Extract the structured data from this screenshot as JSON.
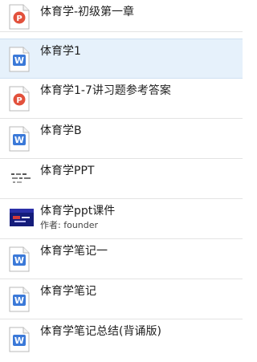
{
  "files": [
    {
      "title": "体育学-初级第一章",
      "icon": "pdf-icon"
    },
    {
      "title": "体育学1",
      "icon": "word-icon"
    },
    {
      "title": "体育学1-7讲习题参考答案",
      "icon": "pdf-icon"
    },
    {
      "title": "体育学B",
      "icon": "word-icon"
    },
    {
      "title": "体育学PPT",
      "icon": "ppt-thumbnail"
    },
    {
      "title": "体育学ppt课件",
      "icon": "video-thumbnail",
      "author_label": "作者:",
      "author": "founder"
    },
    {
      "title": "体育学笔记一",
      "icon": "word-icon"
    },
    {
      "title": "体育学笔记",
      "icon": "word-icon"
    },
    {
      "title": "体育学笔记总结(背诵版)",
      "icon": "word-icon"
    }
  ],
  "colors": {
    "pdf_accent": "#e2513c",
    "word_accent": "#3b79d8",
    "selected_bg": "#e6f1fb",
    "divider": "#e3e3e3"
  }
}
